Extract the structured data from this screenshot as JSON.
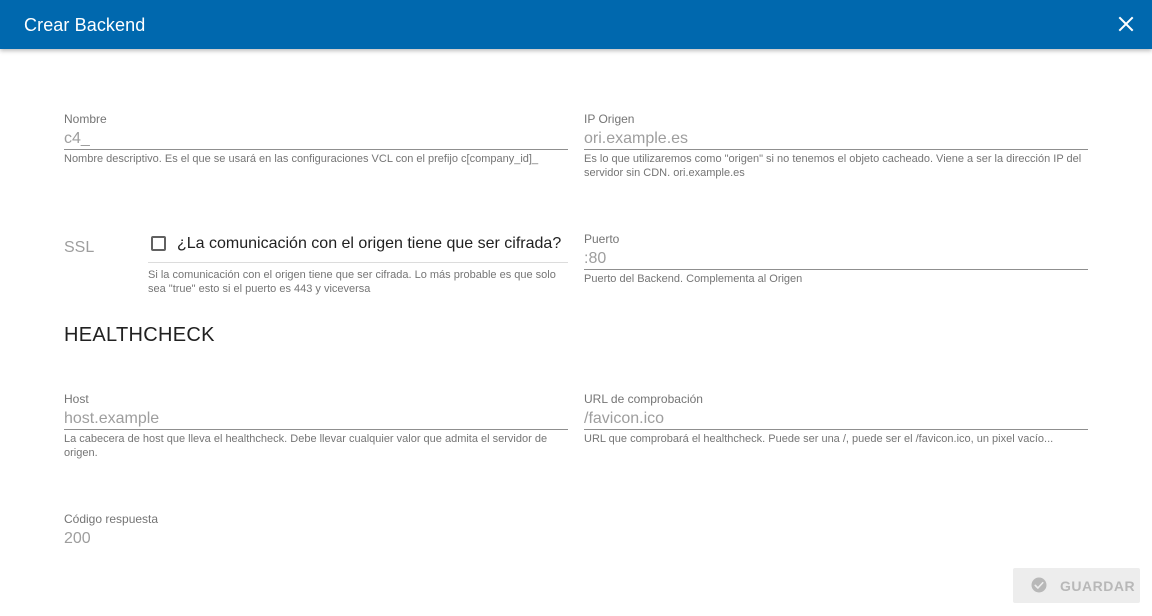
{
  "dialog": {
    "title": "Crear Backend",
    "close_icon": "close-icon"
  },
  "form": {
    "nombre": {
      "label": "Nombre",
      "value": "c4_",
      "hint": "Nombre descriptivo. Es el que se usará en las configuraciones VCL con el prefijo c[company_id]_"
    },
    "ip_origen": {
      "label": "IP Origen",
      "value": "ori.example.es",
      "hint": "Es lo que utilizaremos como \"origen\" si no tenemos el objeto cacheado. Viene a ser la dirección IP del servidor sin CDN. ori.example.es"
    },
    "ssl": {
      "label": "SSL",
      "checkbox_label": "¿La comunicación con el origen tiene que ser cifrada?",
      "checked": false,
      "hint": "Si la comunicación con el origen tiene que ser cifrada. Lo más probable es que solo sea \"true\" esto si el puerto es 443 y viceversa"
    },
    "puerto": {
      "label": "Puerto",
      "value": ":80",
      "hint": "Puerto del Backend. Complementa al Origen"
    }
  },
  "healthcheck": {
    "title": "HEALTHCHECK",
    "host": {
      "label": "Host",
      "value": "host.example",
      "hint": "La cabecera de host que lleva el healthcheck. Debe llevar cualquier valor que admita el servidor de origen."
    },
    "url": {
      "label": "URL de comprobación",
      "value": "/favicon.ico",
      "hint": "URL que comprobará el healthcheck. Puede ser una /, puede ser el /favicon.ico, un pixel vacío..."
    },
    "codigo": {
      "label": "Código respuesta",
      "value": "200"
    }
  },
  "actions": {
    "save_label": "GUARDAR",
    "save_icon": "check-circle-icon"
  },
  "colors": {
    "toolbar": "#0068ae",
    "text_primary": "#212121",
    "text_secondary": "#757575",
    "value_text": "#9e9e9e",
    "button_disabled_bg": "#ededed",
    "button_disabled_text": "#b8b8b8"
  }
}
